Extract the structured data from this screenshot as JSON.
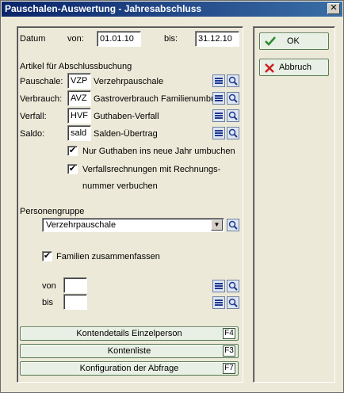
{
  "window": {
    "title": "Pauschalen-Auswertung - Jahresabschluss",
    "close_glyph": "✕"
  },
  "dates": {
    "label": "Datum",
    "from_label": "von:",
    "from_value": "01.01.10",
    "to_label": "bis:",
    "to_value": "31.12.10"
  },
  "articles": {
    "group_label": "Artikel für Abschlussbuchung",
    "rows": [
      {
        "label": "Pauschale:",
        "code": "VZP",
        "desc": "Verzehrpauschale"
      },
      {
        "label": "Verbrauch:",
        "code": "AVZ",
        "desc": "Gastroverbrauch Familienumbu"
      },
      {
        "label": "Verfall:",
        "code": "HVF",
        "desc": "Guthaben-Verfall"
      },
      {
        "label": "Saldo:",
        "code": "sald",
        "desc": "Salden-Übertrag"
      }
    ]
  },
  "options": {
    "only_credit": {
      "label": "Nur Guthaben ins neue Jahr umbuchen",
      "checked": true
    },
    "expiry_invoices": {
      "label_line1": "Verfallsrechnungen mit Rechnungs-",
      "label_line2": "nummer verbuchen",
      "checked": true
    }
  },
  "person_group": {
    "label": "Personengruppe",
    "selected": "Verzehrpauschale",
    "families_label": "Familien zusammenfassen",
    "families_checked": true,
    "from_label": "von",
    "from_value": "",
    "to_label": "bis",
    "to_value": ""
  },
  "buttons": {
    "details": {
      "label": "Kontendetails Einzelperson",
      "key": "F4"
    },
    "list": {
      "label": "Kontenliste",
      "key": "F3"
    },
    "config": {
      "label": "Konfiguration der Abfrage",
      "key": "F7"
    },
    "ok": "OK",
    "cancel": "Abbruch"
  },
  "colors": {
    "titlebar_start": "#0a246a",
    "ok_icon": "#2e8b2e",
    "cancel_icon": "#cc2222"
  }
}
